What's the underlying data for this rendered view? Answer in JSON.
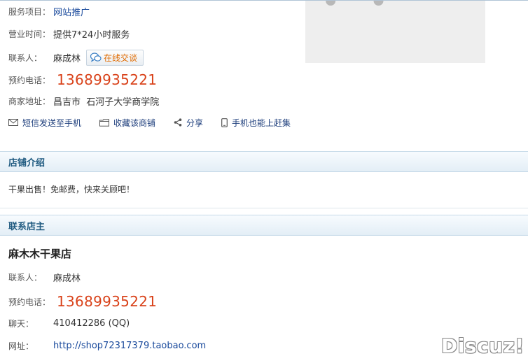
{
  "info": {
    "service": {
      "label": "服务项目：",
      "value": "网站推广"
    },
    "hours": {
      "label": "营业时间：",
      "value": "提供7*24小时服务"
    },
    "contact": {
      "label": "联系人：",
      "value": "麻成林",
      "chat_button": "在线交谈"
    },
    "phone": {
      "label": "预约电话：",
      "value": "13689935221"
    },
    "address": {
      "label": "商家地址：",
      "value": "昌吉市  石河子大学商学院"
    }
  },
  "actions": {
    "sms": "短信发送至手机",
    "favorite": "收藏该商铺",
    "share": "分享",
    "mobile": "手机也能上赶集"
  },
  "intro": {
    "title": "店铺介绍",
    "text": "干果出售！免邮费，快来关顾吧！"
  },
  "owner": {
    "title": "联系店主",
    "shop_name": "麻木木干果店",
    "contact": {
      "label": "联系人：",
      "value": "麻成林"
    },
    "phone": {
      "label": "预约电话：",
      "value": "13689935221"
    },
    "chat": {
      "label": "聊天：",
      "value": "410412286 (QQ)"
    },
    "website": {
      "label": "网址：",
      "value": "http://shop72317379.taobao.com"
    }
  },
  "watermark": "Discuz!",
  "colors": {
    "phone": "#d9421a",
    "link": "#1a4a9c",
    "section_title": "#1f5a80",
    "chat_text": "#e06b00"
  }
}
